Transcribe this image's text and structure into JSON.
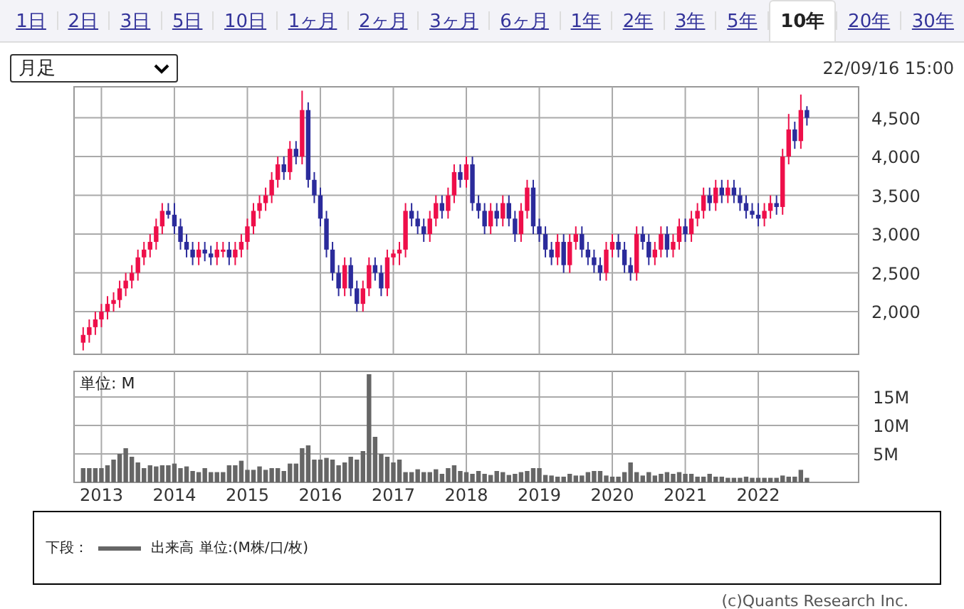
{
  "tabs": [
    {
      "label": "1日",
      "selected": false
    },
    {
      "label": "2日",
      "selected": false
    },
    {
      "label": "3日",
      "selected": false
    },
    {
      "label": "5日",
      "selected": false
    },
    {
      "label": "10日",
      "selected": false
    },
    {
      "label": "1ヶ月",
      "selected": false
    },
    {
      "label": "2ヶ月",
      "selected": false
    },
    {
      "label": "3ヶ月",
      "selected": false
    },
    {
      "label": "6ヶ月",
      "selected": false
    },
    {
      "label": "1年",
      "selected": false
    },
    {
      "label": "2年",
      "selected": false
    },
    {
      "label": "3年",
      "selected": false
    },
    {
      "label": "5年",
      "selected": false
    },
    {
      "label": "10年",
      "selected": true
    },
    {
      "label": "20年",
      "selected": false
    },
    {
      "label": "30年",
      "selected": false
    }
  ],
  "period_select": {
    "value": "月足"
  },
  "timestamp": "22/09/16 15:00",
  "price_chart": {
    "chart_data": {
      "type": "candlestick",
      "grid": true,
      "ylim": [
        1450,
        4900
      ],
      "yticks": [
        {
          "value": 2000,
          "label": "2,000"
        },
        {
          "value": 2500,
          "label": "2,500"
        },
        {
          "value": 3000,
          "label": "3,000"
        },
        {
          "value": 3500,
          "label": "3,500"
        },
        {
          "value": 4000,
          "label": "4,000"
        },
        {
          "value": 4500,
          "label": "4,500"
        }
      ],
      "categories": [
        null,
        null,
        null,
        null,
        null,
        null,
        null,
        null,
        null,
        null,
        null,
        null,
        null,
        null,
        null,
        null,
        null,
        null,
        null,
        null,
        null,
        null,
        null,
        null,
        null,
        null,
        null,
        null,
        null,
        null,
        null,
        null,
        null,
        null,
        null,
        null,
        null,
        null,
        null,
        null,
        null,
        null,
        null,
        null,
        null,
        null,
        null,
        null,
        null,
        null,
        null,
        null,
        null,
        null,
        null,
        null,
        null,
        null,
        null,
        null,
        null,
        null,
        null,
        null,
        null,
        null,
        null,
        null,
        null,
        null,
        null,
        null,
        null,
        null,
        null,
        null,
        null,
        null,
        null,
        null,
        null,
        null,
        null,
        null,
        null,
        null,
        null,
        null,
        null,
        null,
        null,
        null,
        null,
        null,
        null,
        null,
        null,
        null,
        null,
        null,
        null,
        null,
        null,
        null,
        null,
        null,
        null,
        null,
        null,
        null,
        null,
        null,
        null,
        null,
        null,
        null,
        null,
        null,
        null,
        null,
        null,
        null,
        null,
        null,
        null,
        null,
        null,
        null,
        null
      ],
      "ohlc": [
        null,
        [
          1600,
          1800,
          1500,
          1700
        ],
        [
          1700,
          1900,
          1600,
          1800
        ],
        [
          1800,
          2000,
          1700,
          1900
        ],
        [
          1900,
          2100,
          1800,
          2000
        ],
        [
          2000,
          2200,
          1900,
          2100
        ],
        [
          2100,
          2250,
          2000,
          2150
        ],
        [
          2150,
          2400,
          2050,
          2300
        ],
        [
          2300,
          2500,
          2200,
          2400
        ],
        [
          2400,
          2600,
          2300,
          2500
        ],
        [
          2500,
          2800,
          2400,
          2700
        ],
        [
          2700,
          2900,
          2600,
          2800
        ],
        [
          2800,
          3000,
          2700,
          2900
        ],
        [
          2900,
          3200,
          2800,
          3100
        ],
        [
          3100,
          3400,
          3000,
          3300
        ],
        [
          3300,
          3400,
          3200,
          3250
        ],
        [
          3250,
          3400,
          3000,
          3100
        ],
        [
          3100,
          3200,
          2800,
          2900
        ],
        [
          2900,
          3000,
          2700,
          2800
        ],
        [
          2800,
          2900,
          2600,
          2700
        ],
        [
          2700,
          2900,
          2600,
          2800
        ],
        [
          2800,
          2900,
          2650,
          2750
        ],
        [
          2750,
          2850,
          2600,
          2700
        ],
        [
          2700,
          2900,
          2600,
          2800
        ],
        [
          2800,
          2900,
          2700,
          2800
        ],
        [
          2800,
          2900,
          2600,
          2700
        ],
        [
          2700,
          2900,
          2600,
          2800
        ],
        [
          2800,
          3000,
          2700,
          2900
        ],
        [
          2900,
          3200,
          2800,
          3100
        ],
        [
          3100,
          3400,
          3000,
          3300
        ],
        [
          3300,
          3500,
          3200,
          3400
        ],
        [
          3400,
          3600,
          3300,
          3500
        ],
        [
          3500,
          3800,
          3400,
          3700
        ],
        [
          3700,
          4000,
          3600,
          3900
        ],
        [
          3900,
          4000,
          3700,
          3800
        ],
        [
          3800,
          4200,
          3700,
          4100
        ],
        [
          4100,
          4200,
          3900,
          4000
        ],
        [
          4000,
          4850,
          3900,
          4600
        ],
        [
          4600,
          4700,
          3600,
          3700
        ],
        [
          3700,
          3800,
          3400,
          3500
        ],
        [
          3500,
          3600,
          3100,
          3200
        ],
        [
          3200,
          3300,
          2700,
          2800
        ],
        [
          2800,
          2900,
          2400,
          2500
        ],
        [
          2500,
          2600,
          2200,
          2300
        ],
        [
          2300,
          2700,
          2200,
          2600
        ],
        [
          2600,
          2700,
          2200,
          2300
        ],
        [
          2300,
          2400,
          2000,
          2100
        ],
        [
          2100,
          2400,
          2000,
          2300
        ],
        [
          2300,
          2700,
          2200,
          2600
        ],
        [
          2600,
          2700,
          2400,
          2500
        ],
        [
          2500,
          2600,
          2200,
          2300
        ],
        [
          2300,
          2800,
          2200,
          2700
        ],
        [
          2700,
          2800,
          2600,
          2750
        ],
        [
          2750,
          2900,
          2600,
          2800
        ],
        [
          2800,
          3400,
          2700,
          3300
        ],
        [
          3300,
          3400,
          3100,
          3200
        ],
        [
          3200,
          3300,
          3000,
          3100
        ],
        [
          3100,
          3200,
          2900,
          3000
        ],
        [
          3000,
          3300,
          2900,
          3200
        ],
        [
          3200,
          3500,
          3100,
          3400
        ],
        [
          3400,
          3500,
          3200,
          3300
        ],
        [
          3300,
          3600,
          3200,
          3500
        ],
        [
          3500,
          3900,
          3400,
          3800
        ],
        [
          3800,
          3900,
          3600,
          3700
        ],
        [
          3700,
          4000,
          3600,
          3900
        ],
        [
          3900,
          4000,
          3300,
          3400
        ],
        [
          3400,
          3500,
          3200,
          3300
        ],
        [
          3300,
          3400,
          3000,
          3100
        ],
        [
          3100,
          3400,
          3000,
          3300
        ],
        [
          3300,
          3400,
          3100,
          3200
        ],
        [
          3200,
          3500,
          3100,
          3400
        ],
        [
          3400,
          3500,
          3100,
          3200
        ],
        [
          3200,
          3300,
          2900,
          3000
        ],
        [
          3000,
          3400,
          2900,
          3300
        ],
        [
          3300,
          3700,
          3200,
          3600
        ],
        [
          3600,
          3700,
          3000,
          3100
        ],
        [
          3100,
          3200,
          2900,
          3000
        ],
        [
          3000,
          3100,
          2700,
          2800
        ],
        [
          2800,
          2900,
          2600,
          2700
        ],
        [
          2700,
          3000,
          2600,
          2900
        ],
        [
          2900,
          3000,
          2500,
          2600
        ],
        [
          2600,
          3000,
          2500,
          2900
        ],
        [
          2900,
          3100,
          2800,
          3000
        ],
        [
          3000,
          3100,
          2700,
          2800
        ],
        [
          2800,
          2900,
          2600,
          2700
        ],
        [
          2700,
          2800,
          2500,
          2600
        ],
        [
          2600,
          2700,
          2400,
          2500
        ],
        [
          2500,
          2900,
          2400,
          2800
        ],
        [
          2800,
          3000,
          2700,
          2900
        ],
        [
          2900,
          3000,
          2700,
          2800
        ],
        [
          2800,
          2900,
          2500,
          2600
        ],
        [
          2600,
          2700,
          2400,
          2500
        ],
        [
          2500,
          3100,
          2400,
          3000
        ],
        [
          3000,
          3100,
          2800,
          2900
        ],
        [
          2900,
          3000,
          2600,
          2700
        ],
        [
          2700,
          2900,
          2600,
          2800
        ],
        [
          2800,
          3100,
          2700,
          3000
        ],
        [
          3000,
          3100,
          2700,
          2800
        ],
        [
          2800,
          3000,
          2700,
          2900
        ],
        [
          2900,
          3200,
          2800,
          3100
        ],
        [
          3100,
          3200,
          2900,
          3000
        ],
        [
          3000,
          3300,
          2900,
          3200
        ],
        [
          3200,
          3400,
          3100,
          3300
        ],
        [
          3300,
          3600,
          3200,
          3500
        ],
        [
          3500,
          3600,
          3300,
          3400
        ],
        [
          3400,
          3700,
          3300,
          3600
        ],
        [
          3600,
          3700,
          3400,
          3500
        ],
        [
          3500,
          3700,
          3400,
          3600
        ],
        [
          3600,
          3700,
          3400,
          3500
        ],
        [
          3500,
          3600,
          3300,
          3400
        ],
        [
          3400,
          3500,
          3200,
          3300
        ],
        [
          3300,
          3400,
          3200,
          3250
        ],
        [
          3250,
          3400,
          3100,
          3200
        ],
        [
          3200,
          3400,
          3100,
          3300
        ],
        [
          3300,
          3500,
          3200,
          3400
        ],
        [
          3400,
          3500,
          3250,
          3350
        ],
        [
          3350,
          4100,
          3250,
          4000
        ],
        [
          4000,
          4550,
          3900,
          4350
        ],
        [
          4350,
          4450,
          4100,
          4200
        ],
        [
          4200,
          4800,
          4100,
          4600
        ],
        [
          4600,
          4650,
          4400,
          4500
        ],
        null,
        null,
        null,
        null,
        null,
        null,
        null,
        null
      ]
    }
  },
  "volume_chart": {
    "unit_label": "単位: M",
    "chart_data": {
      "type": "bar",
      "grid": true,
      "ylim": [
        0,
        19.5
      ],
      "categories": [
        null,
        null,
        null,
        null,
        "2013",
        null,
        null,
        null,
        null,
        null,
        null,
        null,
        null,
        null,
        null,
        null,
        "2014",
        null,
        null,
        null,
        null,
        null,
        null,
        null,
        null,
        null,
        null,
        null,
        "2015",
        null,
        null,
        null,
        null,
        null,
        null,
        null,
        null,
        null,
        null,
        null,
        "2016",
        null,
        null,
        null,
        null,
        null,
        null,
        null,
        null,
        null,
        null,
        null,
        "2017",
        null,
        null,
        null,
        null,
        null,
        null,
        null,
        null,
        null,
        null,
        null,
        "2018",
        null,
        null,
        null,
        null,
        null,
        null,
        null,
        null,
        null,
        null,
        null,
        "2019",
        null,
        null,
        null,
        null,
        null,
        null,
        null,
        null,
        null,
        null,
        null,
        "2020",
        null,
        null,
        null,
        null,
        null,
        null,
        null,
        null,
        null,
        null,
        null,
        "2021",
        null,
        null,
        null,
        null,
        null,
        null,
        null,
        null,
        null,
        null,
        null,
        "2022",
        null,
        null,
        null,
        null,
        null,
        null,
        null,
        null,
        null,
        null,
        null,
        null,
        null,
        null,
        null,
        null
      ],
      "yticks": [
        {
          "value": 5,
          "label": "5M"
        },
        {
          "value": 10,
          "label": "10M"
        },
        {
          "value": 15,
          "label": "15M"
        }
      ],
      "series": [
        {
          "name": "出来高",
          "color": "#666666",
          "values": [
            null,
            2.5,
            2.5,
            2.5,
            2.5,
            3,
            4,
            5,
            6,
            4.5,
            3.5,
            2.5,
            3,
            2.8,
            3,
            3,
            3.3,
            2.5,
            2.8,
            2,
            1.8,
            2.5,
            1.8,
            1.8,
            1.8,
            3,
            3,
            3.8,
            2.2,
            2.2,
            2.8,
            2.2,
            2.5,
            2.5,
            2,
            3.3,
            3.3,
            6,
            6.5,
            4,
            4,
            4.3,
            4,
            3,
            3.5,
            4.5,
            4,
            5.5,
            19,
            8,
            5,
            4.5,
            3.5,
            4,
            1.8,
            1.8,
            2.3,
            1.8,
            1.8,
            2.3,
            1.5,
            2.5,
            3,
            2,
            1.8,
            1.5,
            2,
            1.5,
            1.3,
            2,
            1.8,
            1.3,
            1.5,
            1.8,
            2,
            2.5,
            2.5,
            1.3,
            1.2,
            1,
            1,
            1.5,
            1.2,
            1.2,
            1.8,
            2,
            2,
            1.2,
            1,
            1,
            1.8,
            3.5,
            1.8,
            1.2,
            1.8,
            1.2,
            1.5,
            1.8,
            1.5,
            1.8,
            1.5,
            1.5,
            1,
            1,
            1.5,
            1,
            1,
            0.8,
            0.8,
            0.8,
            1,
            0.8,
            0.8,
            0.8,
            0.8,
            0.8,
            1.2,
            1,
            1,
            2.2,
            0.8,
            null,
            null,
            null,
            null,
            null,
            null,
            null,
            null
          ]
        }
      ]
    }
  },
  "legend": {
    "label": "下段：",
    "unit": "単位:(M株/口/枚)"
  },
  "copyright": "(c)Quants Research Inc."
}
